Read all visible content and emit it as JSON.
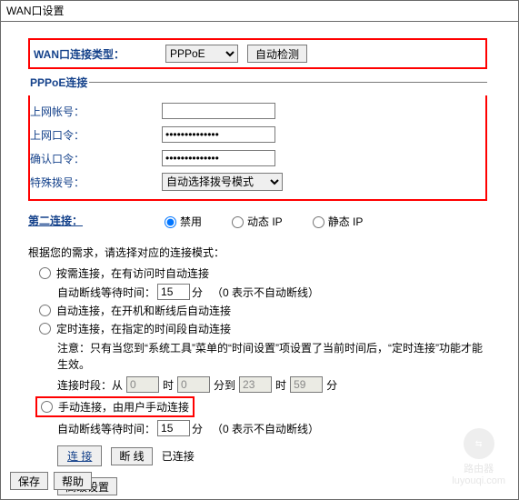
{
  "window_title": "WAN口设置",
  "top": {
    "conn_type_label": "WAN口连接类型：",
    "conn_type_value": "PPPoE",
    "auto_detect": "自动检测"
  },
  "pppoe": {
    "legend": "PPPoE连接",
    "user_label": "上网帐号：",
    "user_value": "",
    "pass_label": "上网口令：",
    "pass_value": "••••••••••••••",
    "confirm_label": "确认口令：",
    "confirm_value": "••••••••••••••",
    "dial_label": "特殊拨号：",
    "dial_value": "自动选择拨号模式"
  },
  "second": {
    "label": "第二连接：",
    "disable": "禁用",
    "dyn": "动态 IP",
    "stat": "静态 IP"
  },
  "mode": {
    "hint": "根据您的需求，请选择对应的连接模式：",
    "on_demand": "按需连接，在有访问时自动连接",
    "idle_label_prefix": "自动断线等待时间：",
    "idle_value": "15",
    "idle_unit": "分",
    "idle_note": "（0 表示不自动断线）",
    "auto": "自动连接，在开机和断线后自动连接",
    "scheduled": "定时连接，在指定的时间段自动连接",
    "note": "注意：只有当您到“系统工具”菜单的“时间设置”项设置了当前时间后，“定时连接”功能才能生效。",
    "time_prefix": "连接时段：从",
    "t_from_h": "0",
    "hour": "时",
    "t_from_m": "0",
    "to": "分到",
    "t_to_h": "23",
    "t_to_m": "59",
    "minute": "分",
    "manual": "手动连接，由用户手动连接",
    "idle2_value": "15"
  },
  "buttons": {
    "connect": "连 接",
    "disconnect": "断 线",
    "status": "已连接",
    "advanced": "高级设置",
    "save": "保存",
    "help": "帮助"
  },
  "watermark": {
    "text": "路由器",
    "url": "luyouqi.com"
  }
}
